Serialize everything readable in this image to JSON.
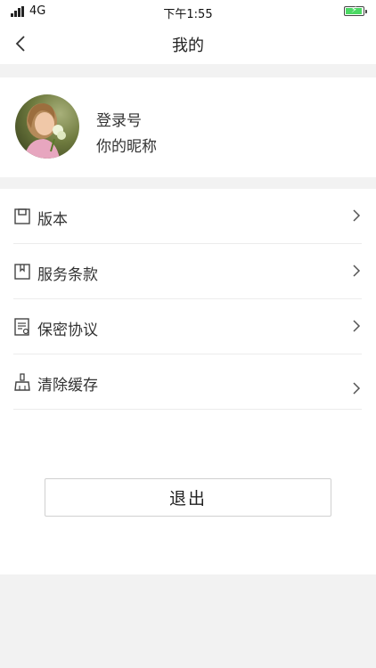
{
  "status_bar": {
    "carrier": "4G",
    "time": "下午1:55"
  },
  "nav": {
    "title": "我的",
    "back_icon": "chevron-left-icon"
  },
  "profile": {
    "login_id": "登录号",
    "nickname": "你的昵称"
  },
  "menu": {
    "items": [
      {
        "label": "版本",
        "icon": "save-icon"
      },
      {
        "label": "服务条款",
        "icon": "bookmark-icon"
      },
      {
        "label": "保密协议",
        "icon": "document-icon"
      },
      {
        "label": "清除缓存",
        "icon": "broom-icon"
      }
    ]
  },
  "logout": {
    "label": "退出"
  },
  "colors": {
    "background": "#f2f2f2",
    "battery": "#4cd964",
    "divider": "#ececec"
  }
}
